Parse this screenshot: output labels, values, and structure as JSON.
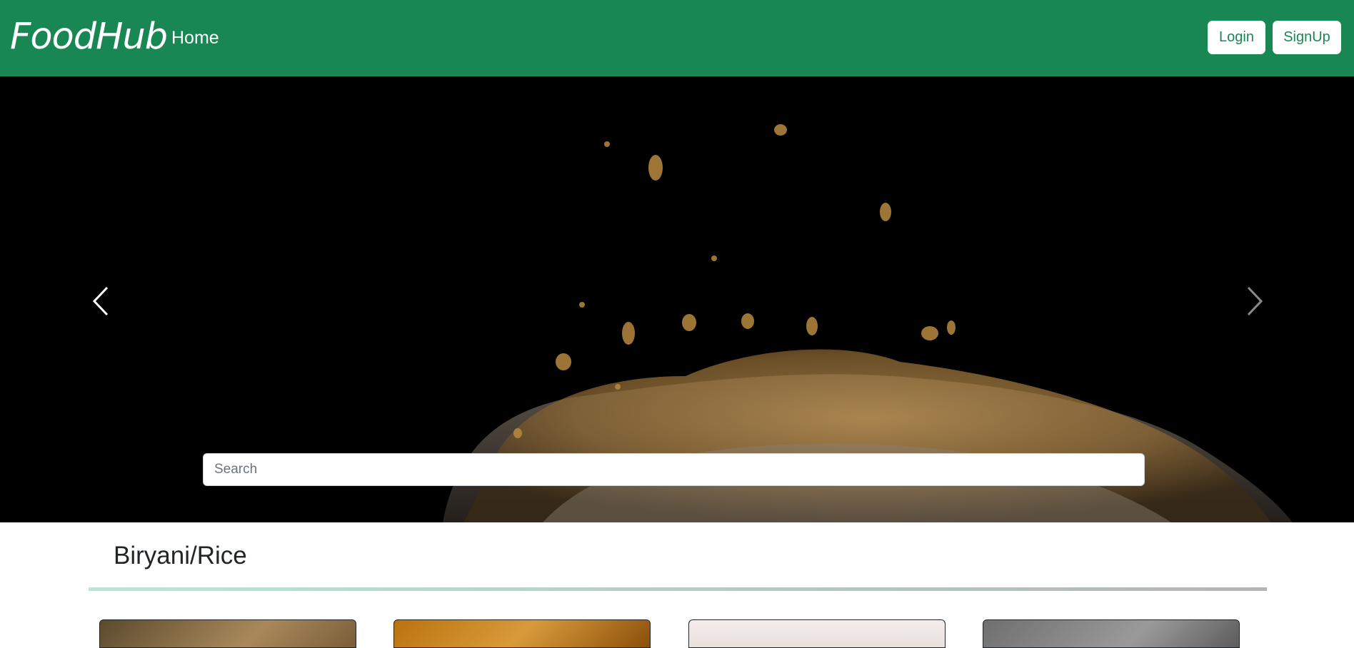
{
  "navbar": {
    "brand": "FoodHub",
    "home_label": "Home",
    "login_label": "Login",
    "signup_label": "SignUp"
  },
  "hero": {
    "prev_icon": "chevron-left-icon",
    "next_icon": "chevron-right-icon"
  },
  "search": {
    "placeholder": "Search",
    "value": ""
  },
  "section": {
    "title": "Biryani/Rice"
  },
  "cards": [
    {
      "image": "biryani-card-image-1"
    },
    {
      "image": "biryani-card-image-2"
    },
    {
      "image": "biryani-card-image-3"
    },
    {
      "image": "biryani-card-image-4"
    }
  ],
  "colors": {
    "navbar_bg": "#198754",
    "brand_text": "#ffffff",
    "button_bg": "#ffffff",
    "button_text": "#198754",
    "hero_bg": "#000000"
  }
}
